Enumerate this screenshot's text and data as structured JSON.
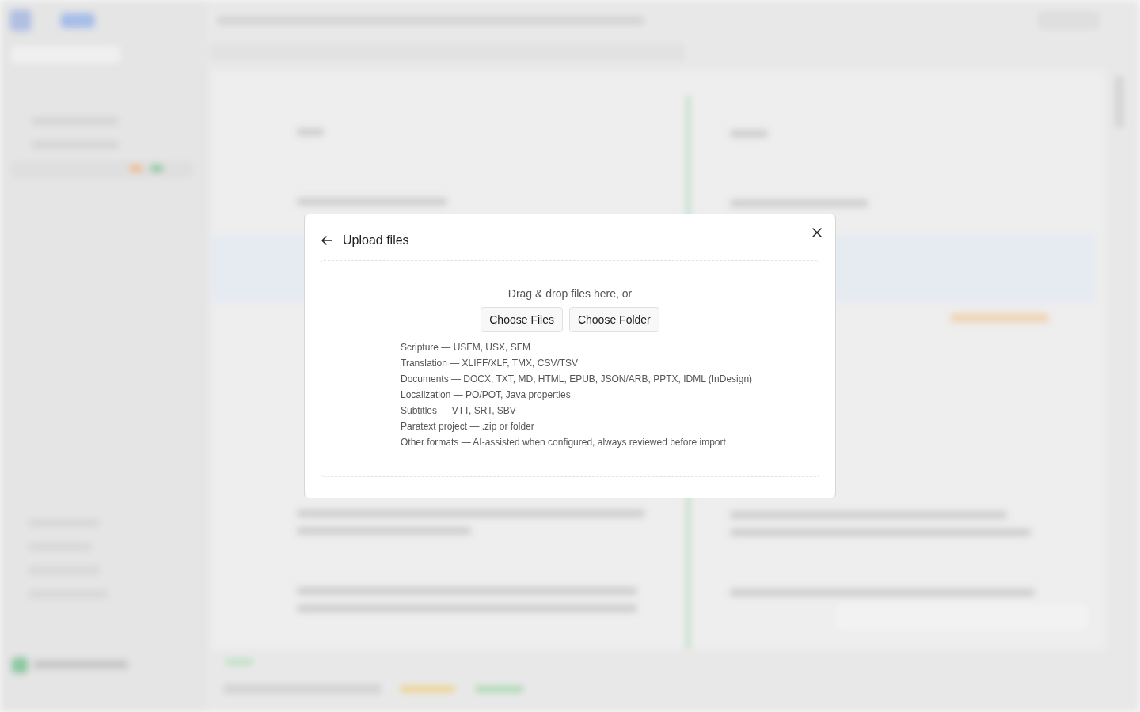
{
  "dialog": {
    "title": "Upload files",
    "dropzone": {
      "prompt": "Drag & drop files here, or",
      "buttons": [
        "Choose Files",
        "Choose Folder"
      ],
      "formats": [
        "Scripture — USFM, USX, SFM",
        "Translation — XLIFF/XLF, TMX, CSV/TSV",
        "Documents — DOCX, TXT, MD, HTML, EPUB, JSON/ARB, PPTX, IDML (InDesign)",
        "Localization — PO/POT, Java properties",
        "Subtitles — VTT, SRT, SBV",
        "Paratext project — .zip or folder",
        "Other formats — AI-assisted when configured, always reviewed before import"
      ]
    }
  }
}
